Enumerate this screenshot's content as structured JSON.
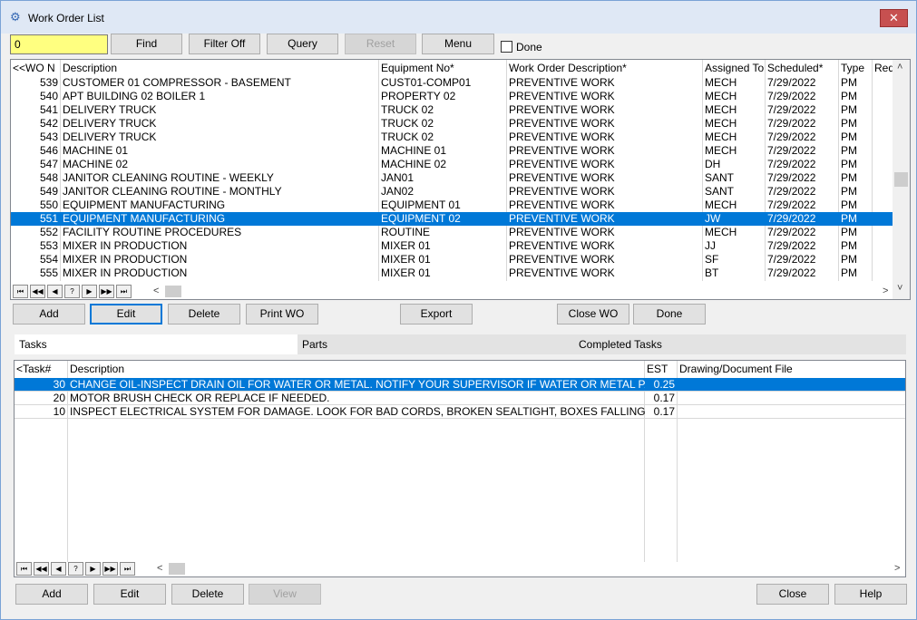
{
  "window": {
    "title": "Work Order List",
    "close_glyph": "✕",
    "icon": "gear-icon"
  },
  "toolbar": {
    "search_value": "0",
    "find": "Find",
    "filter_off": "Filter Off",
    "query": "Query",
    "reset": "Reset",
    "menu": "Menu",
    "done_label": "Done"
  },
  "wo_grid": {
    "headers": [
      "<<WO N",
      "Description",
      "Equipment No*",
      "Work Order Description*",
      "Assigned To",
      "Scheduled*",
      "Type",
      "Req"
    ],
    "rows": [
      [
        "539",
        "CUSTOMER 01 COMPRESSOR - BASEMENT",
        "CUST01-COMP01",
        "PREVENTIVE WORK",
        "MECH",
        "7/29/2022",
        "PM"
      ],
      [
        "540",
        "APT BUILDING 02 BOILER 1",
        "PROPERTY 02",
        "PREVENTIVE WORK",
        "MECH",
        "7/29/2022",
        "PM"
      ],
      [
        "541",
        "DELIVERY TRUCK",
        "TRUCK 02",
        "PREVENTIVE WORK",
        "MECH",
        "7/29/2022",
        "PM"
      ],
      [
        "542",
        "DELIVERY TRUCK",
        "TRUCK 02",
        "PREVENTIVE WORK",
        "MECH",
        "7/29/2022",
        "PM"
      ],
      [
        "543",
        "DELIVERY TRUCK",
        "TRUCK 02",
        "PREVENTIVE WORK",
        "MECH",
        "7/29/2022",
        "PM"
      ],
      [
        "546",
        "MACHINE 01",
        "MACHINE 01",
        "PREVENTIVE WORK",
        "MECH",
        "7/29/2022",
        "PM"
      ],
      [
        "547",
        "MACHINE 02",
        "MACHINE 02",
        "PREVENTIVE WORK",
        "DH",
        "7/29/2022",
        "PM"
      ],
      [
        "548",
        "JANITOR CLEANING ROUTINE - WEEKLY",
        "JAN01",
        "PREVENTIVE WORK",
        "SANT",
        "7/29/2022",
        "PM"
      ],
      [
        "549",
        "JANITOR CLEANING ROUTINE - MONTHLY",
        "JAN02",
        "PREVENTIVE WORK",
        "SANT",
        "7/29/2022",
        "PM"
      ],
      [
        "550",
        "EQUIPMENT MANUFACTURING",
        "EQUIPMENT 01",
        "PREVENTIVE WORK",
        "MECH",
        "7/29/2022",
        "PM"
      ],
      [
        "551",
        "EQUIPMENT MANUFACTURING",
        "EQUIPMENT 02",
        "PREVENTIVE WORK",
        "JW",
        "7/29/2022",
        "PM"
      ],
      [
        "552",
        "FACILITY ROUTINE PROCEDURES",
        "ROUTINE",
        "PREVENTIVE WORK",
        "MECH",
        "7/29/2022",
        "PM"
      ],
      [
        "553",
        "MIXER IN PRODUCTION",
        "MIXER 01",
        "PREVENTIVE WORK",
        "JJ",
        "7/29/2022",
        "PM"
      ],
      [
        "554",
        "MIXER IN PRODUCTION",
        "MIXER 01",
        "PREVENTIVE WORK",
        "SF",
        "7/29/2022",
        "PM"
      ],
      [
        "555",
        "MIXER IN PRODUCTION",
        "MIXER 01",
        "PREVENTIVE WORK",
        "BT",
        "7/29/2022",
        "PM"
      ]
    ],
    "selected_row": 10
  },
  "nav_glyphs": [
    "⏮",
    "◀◀",
    "◀",
    "?",
    "▶",
    "▶▶",
    "⏭"
  ],
  "scroll_glyphs": {
    "left": "<",
    "right": ">",
    "up": "˄",
    "down": "˅"
  },
  "wo_actions": {
    "add": "Add",
    "edit": "Edit",
    "delete": "Delete",
    "print": "Print WO",
    "export": "Export",
    "close_wo": "Close WO",
    "done": "Done"
  },
  "tabs": [
    "Tasks",
    "Parts",
    "Completed Tasks"
  ],
  "tasks_grid": {
    "headers": [
      "<Task#",
      "Description",
      "EST",
      "Drawing/Document File"
    ],
    "rows": [
      [
        "30",
        "CHANGE OIL-INSPECT DRAIN OIL FOR WATER OR METAL. NOTIFY YOUR SUPERVISOR IF WATER OR METAL PARTICLES A",
        "0.25",
        ""
      ],
      [
        "20",
        "MOTOR BRUSH CHECK OR REPLACE IF NEEDED.",
        "0.17",
        ""
      ],
      [
        "10",
        "INSPECT ELECTRICAL SYSTEM FOR DAMAGE. LOOK FOR BAD CORDS, BROKEN SEALTIGHT, BOXES FALLING APART OR C",
        "0.17",
        ""
      ]
    ],
    "selected_row": 0
  },
  "bottom_actions": {
    "add": "Add",
    "edit": "Edit",
    "delete": "Delete",
    "view": "View",
    "close": "Close",
    "help": "Help"
  },
  "colors": {
    "selection": "#0078d7",
    "search_bg": "#ffff80"
  }
}
